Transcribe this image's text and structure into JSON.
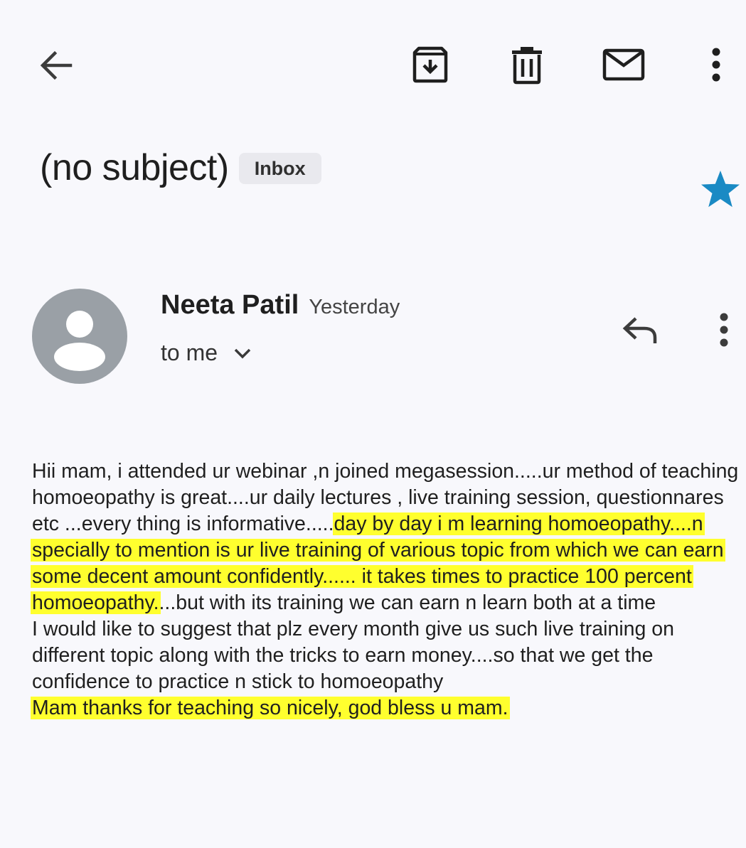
{
  "toolbar": {
    "back_icon": "arrow-left-icon",
    "archive_icon": "archive-icon",
    "delete_icon": "trash-icon",
    "mark_unread_icon": "mail-icon",
    "more_icon": "more-vert-icon"
  },
  "email": {
    "subject": "(no subject)",
    "label": "Inbox",
    "starred": true,
    "star_color": "#1a8ac4",
    "sender": {
      "name": "Neeta Patil",
      "time": "Yesterday",
      "recipient": "to me",
      "avatar_color": "#9aa0a6"
    },
    "highlight_color": "#ffff2e",
    "body": {
      "p1_a": "Hii mam, i attended ur webinar ,n joined megasession.....ur method of teaching homoeopathy is great....ur daily lectures , live training session, questionnares etc ...every thing is informative.....",
      "p1_hl": "day by day i m learning homoeopathy....n specially  to mention is ur live training of various topic from which we can earn some decent amount confidently...... it takes times to practice 100 percent homoeopathy.",
      "p1_b": "...but with its training we can earn n learn both at a time",
      "p2": "I would like to suggest that plz every month give us such live training on different topic along with the tricks to earn money....so that we get the confidence to practice n stick to homoeopathy",
      "p3_hl": "Mam thanks for teaching so nicely, god bless u mam."
    }
  }
}
